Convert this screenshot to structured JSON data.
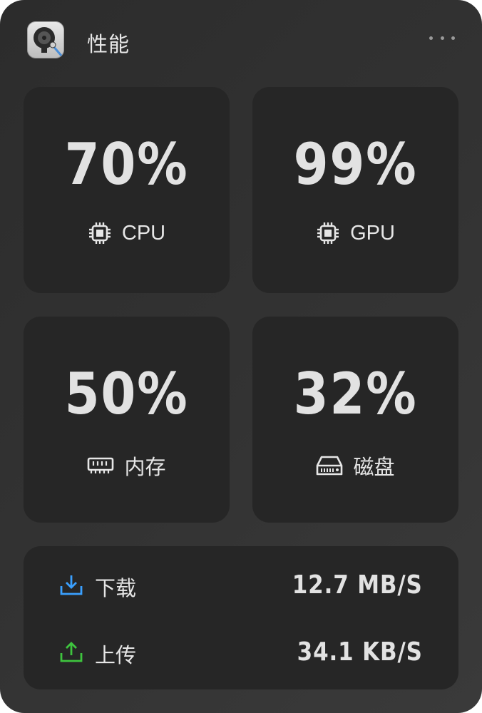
{
  "header": {
    "title": "性能",
    "app_icon": "system-monitor-app-icon",
    "more_icon": "more-dots-icon"
  },
  "metrics": [
    {
      "value": "70%",
      "label": "CPU",
      "icon": "chip-icon"
    },
    {
      "value": "99%",
      "label": "GPU",
      "icon": "chip-icon"
    },
    {
      "value": "50%",
      "label": "内存",
      "icon": "memory-icon"
    },
    {
      "value": "32%",
      "label": "磁盘",
      "icon": "disk-icon"
    }
  ],
  "network": {
    "download": {
      "label": "下载",
      "value": "12.7 MB/S",
      "icon": "download-icon",
      "color": "#3aa0ff"
    },
    "upload": {
      "label": "上传",
      "value": "34.1 KB/S",
      "icon": "upload-icon",
      "color": "#3ec43e"
    }
  },
  "colors": {
    "background": "#333333",
    "card": "#262626",
    "text": "#e2e2e2"
  }
}
